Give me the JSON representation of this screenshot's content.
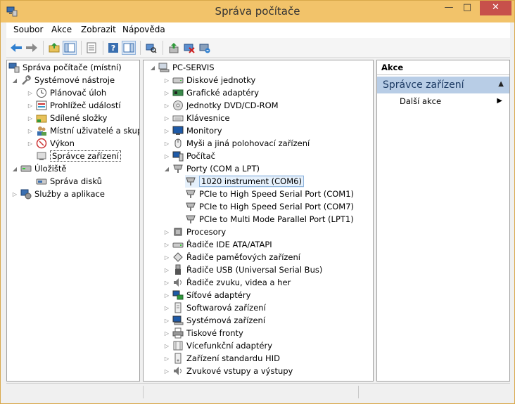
{
  "window": {
    "title": "Správa počítače",
    "min_glyph": "—",
    "max_glyph": "□",
    "close_glyph": "✕"
  },
  "menu": [
    {
      "label": "Soubor"
    },
    {
      "label": "Akce"
    },
    {
      "label": "Zobrazit"
    },
    {
      "label": "Nápověda"
    }
  ],
  "toolbar": {
    "buttons": [
      "back-icon",
      "forward-icon",
      "up-folder-icon",
      "show-hide-tree-icon",
      "properties-icon",
      "help-icon",
      "show-hide-action-pane-icon",
      "scan-hardware-icon",
      "update-driver-icon",
      "disable-device-icon",
      "uninstall-device-icon"
    ]
  },
  "left_tree": {
    "root": "Správa počítače (místní)",
    "items": [
      {
        "label": "Systémové nástroje",
        "icon": "tools-icon"
      },
      {
        "label": "Plánovač úloh",
        "icon": "clock-icon"
      },
      {
        "label": "Prohlížeč událostí",
        "icon": "event-viewer-icon"
      },
      {
        "label": "Sdílené složky",
        "icon": "shared-folder-icon"
      },
      {
        "label": "Místní uživatelé a skupiny",
        "icon": "users-icon"
      },
      {
        "label": "Výkon",
        "icon": "performance-icon"
      },
      {
        "label": "Správce zařízení",
        "icon": "device-manager-icon"
      },
      {
        "label": "Úložiště",
        "icon": "storage-icon"
      },
      {
        "label": "Správa disků",
        "icon": "disk-management-icon"
      },
      {
        "label": "Služby a aplikace",
        "icon": "services-icon"
      }
    ]
  },
  "device_tree": {
    "root": "PC-SERVIS",
    "items": [
      {
        "label": "Diskové jednotky",
        "icon": "disk-drive-icon"
      },
      {
        "label": "Grafické adaptéry",
        "icon": "display-adapter-icon"
      },
      {
        "label": "Jednotky DVD/CD-ROM",
        "icon": "dvd-icon"
      },
      {
        "label": "Klávesnice",
        "icon": "keyboard-icon"
      },
      {
        "label": "Monitory",
        "icon": "monitor-icon"
      },
      {
        "label": "Myši a jiná polohovací zařízení",
        "icon": "mouse-icon"
      },
      {
        "label": "Počítač",
        "icon": "computer-icon"
      },
      {
        "label": "Porty (COM a LPT)",
        "icon": "port-icon"
      },
      {
        "label": "1020 instrument (COM6)",
        "icon": "port-icon"
      },
      {
        "label": "PCIe to High Speed Serial Port (COM1)",
        "icon": "port-icon"
      },
      {
        "label": "PCIe to High Speed Serial Port (COM7)",
        "icon": "port-icon"
      },
      {
        "label": "PCIe to Multi Mode Parallel Port (LPT1)",
        "icon": "port-icon"
      },
      {
        "label": "Procesory",
        "icon": "processor-icon"
      },
      {
        "label": "Řadiče IDE ATA/ATAPI",
        "icon": "ide-controller-icon"
      },
      {
        "label": "Řadiče paměťových zařízení",
        "icon": "storage-controller-icon"
      },
      {
        "label": "Řadiče USB (Universal Serial Bus)",
        "icon": "usb-icon"
      },
      {
        "label": "Řadiče zvuku, videa a her",
        "icon": "sound-icon"
      },
      {
        "label": "Síťové adaptéry",
        "icon": "network-icon"
      },
      {
        "label": "Softwarová zařízení",
        "icon": "software-device-icon"
      },
      {
        "label": "Systémová zařízení",
        "icon": "system-device-icon"
      },
      {
        "label": "Tiskové fronty",
        "icon": "printer-icon"
      },
      {
        "label": "Vícefunkční adaptéry",
        "icon": "multifunction-icon"
      },
      {
        "label": "Zařízení standardu HID",
        "icon": "hid-icon"
      },
      {
        "label": "Zvukové vstupy a výstupy",
        "icon": "audio-io-icon"
      }
    ]
  },
  "actions": {
    "header": "Akce",
    "section": "Správce zařízení",
    "item": "Další akce"
  },
  "colors": {
    "title_bar": "#f2c36a",
    "close_button": "#c7504b",
    "actions_section": "#b8cde6",
    "selection": "#e5f0fb"
  }
}
